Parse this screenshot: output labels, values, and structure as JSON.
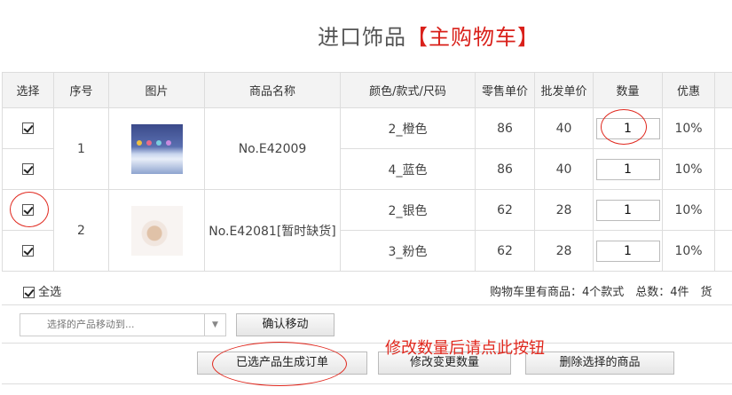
{
  "page": {
    "title_prefix": "进口饰品",
    "title_bracket_open": "【",
    "title_highlight": "主购物车",
    "title_bracket_close": "】"
  },
  "table": {
    "headers": [
      "选择",
      "序号",
      "图片",
      "商品名称",
      "颜色/款式/尺码",
      "零售单价",
      "批发单价",
      "数量",
      "优惠"
    ],
    "products": [
      {
        "index": "1",
        "name": "No.E42009",
        "variants": [
          {
            "option": "2_橙色",
            "retail": "86",
            "wholesale": "40",
            "qty": "1",
            "discount": "10%"
          },
          {
            "option": "4_蓝色",
            "retail": "86",
            "wholesale": "40",
            "qty": "1",
            "discount": "10%"
          }
        ]
      },
      {
        "index": "2",
        "name": "No.E42081[暂时缺货]",
        "variants": [
          {
            "option": "2_银色",
            "retail": "62",
            "wholesale": "28",
            "qty": "1",
            "discount": "10%"
          },
          {
            "option": "3_粉色",
            "retail": "62",
            "wholesale": "28",
            "qty": "1",
            "discount": "10%"
          }
        ]
      }
    ]
  },
  "footer": {
    "select_all": "全选",
    "summary": "购物车里有商品：4个款式　总数：4件　货"
  },
  "actions": {
    "move_placeholder": "选择的产品移动到...",
    "dropdown_arrow": "▼",
    "confirm_move": "确认移动",
    "create_order": "已选产品生成订单",
    "update_qty": "修改变更数量",
    "delete_selected": "删除选择的商品",
    "note": "修改数量后请点此按钮"
  },
  "colors": {
    "accent_red": "#d9201a",
    "header_bg": "#f3f3f3",
    "border": "#dddddd"
  }
}
